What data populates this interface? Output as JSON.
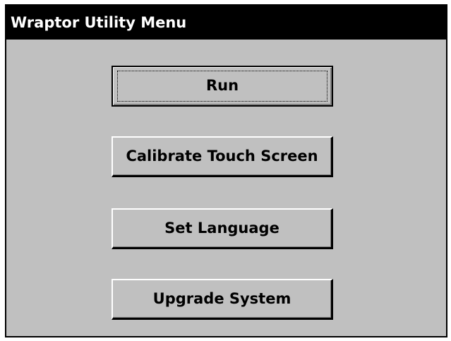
{
  "window": {
    "title": "Wraptor Utility Menu"
  },
  "menu": {
    "buttons": [
      {
        "label": "Run",
        "focused": true
      },
      {
        "label": "Calibrate Touch Screen",
        "focused": false
      },
      {
        "label": "Set Language",
        "focused": false
      },
      {
        "label": "Upgrade System",
        "focused": false
      }
    ]
  },
  "colors": {
    "background": "#c0c0c0",
    "titlebar": "#000000",
    "titlebar_text": "#ffffff"
  }
}
